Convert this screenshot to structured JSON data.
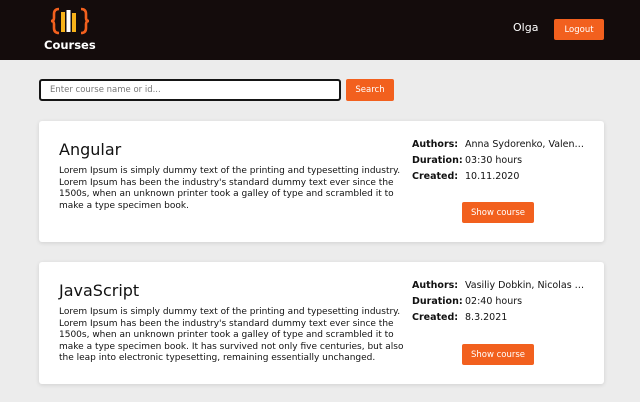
{
  "header": {
    "logo_text": "Courses",
    "username": "Olga",
    "logout_label": "Logout",
    "brand_color": "#f2601e",
    "logo_icon": "book-stack-braces-icon"
  },
  "search": {
    "placeholder": "Enter course name or id...",
    "value": "",
    "button_label": "Search"
  },
  "labels": {
    "authors": "Authors:",
    "duration": "Duration:",
    "created": "Created:"
  },
  "courses": [
    {
      "title": "Angular",
      "description": "Lorem Ipsum is simply dummy text of the printing and typesetting industry. Lorem Ipsum has been the industry's standard dummy text ever since the 1500s, when an unknown printer took a galley of type and scrambled it to make a type specimen book.",
      "authors": "Anna Sydorenko, Valentina Larina",
      "duration": "03:30 hours",
      "created": "10.11.2020",
      "button_label": "Show course"
    },
    {
      "title": "JavaScript",
      "description": "Lorem Ipsum is simply dummy text of the printing and typesetting industry. Lorem Ipsum has been the industry's standard dummy text ever since the 1500s, when an unknown printer took a galley of type and scrambled it to make a type specimen book. It has survived not only five centuries, but also the leap into electronic typesetting, remaining essentially unchanged.",
      "authors": "Vasiliy Dobkin, Nicolas Kim",
      "duration": "02:40 hours",
      "created": "8.3.2021",
      "button_label": "Show course"
    }
  ]
}
